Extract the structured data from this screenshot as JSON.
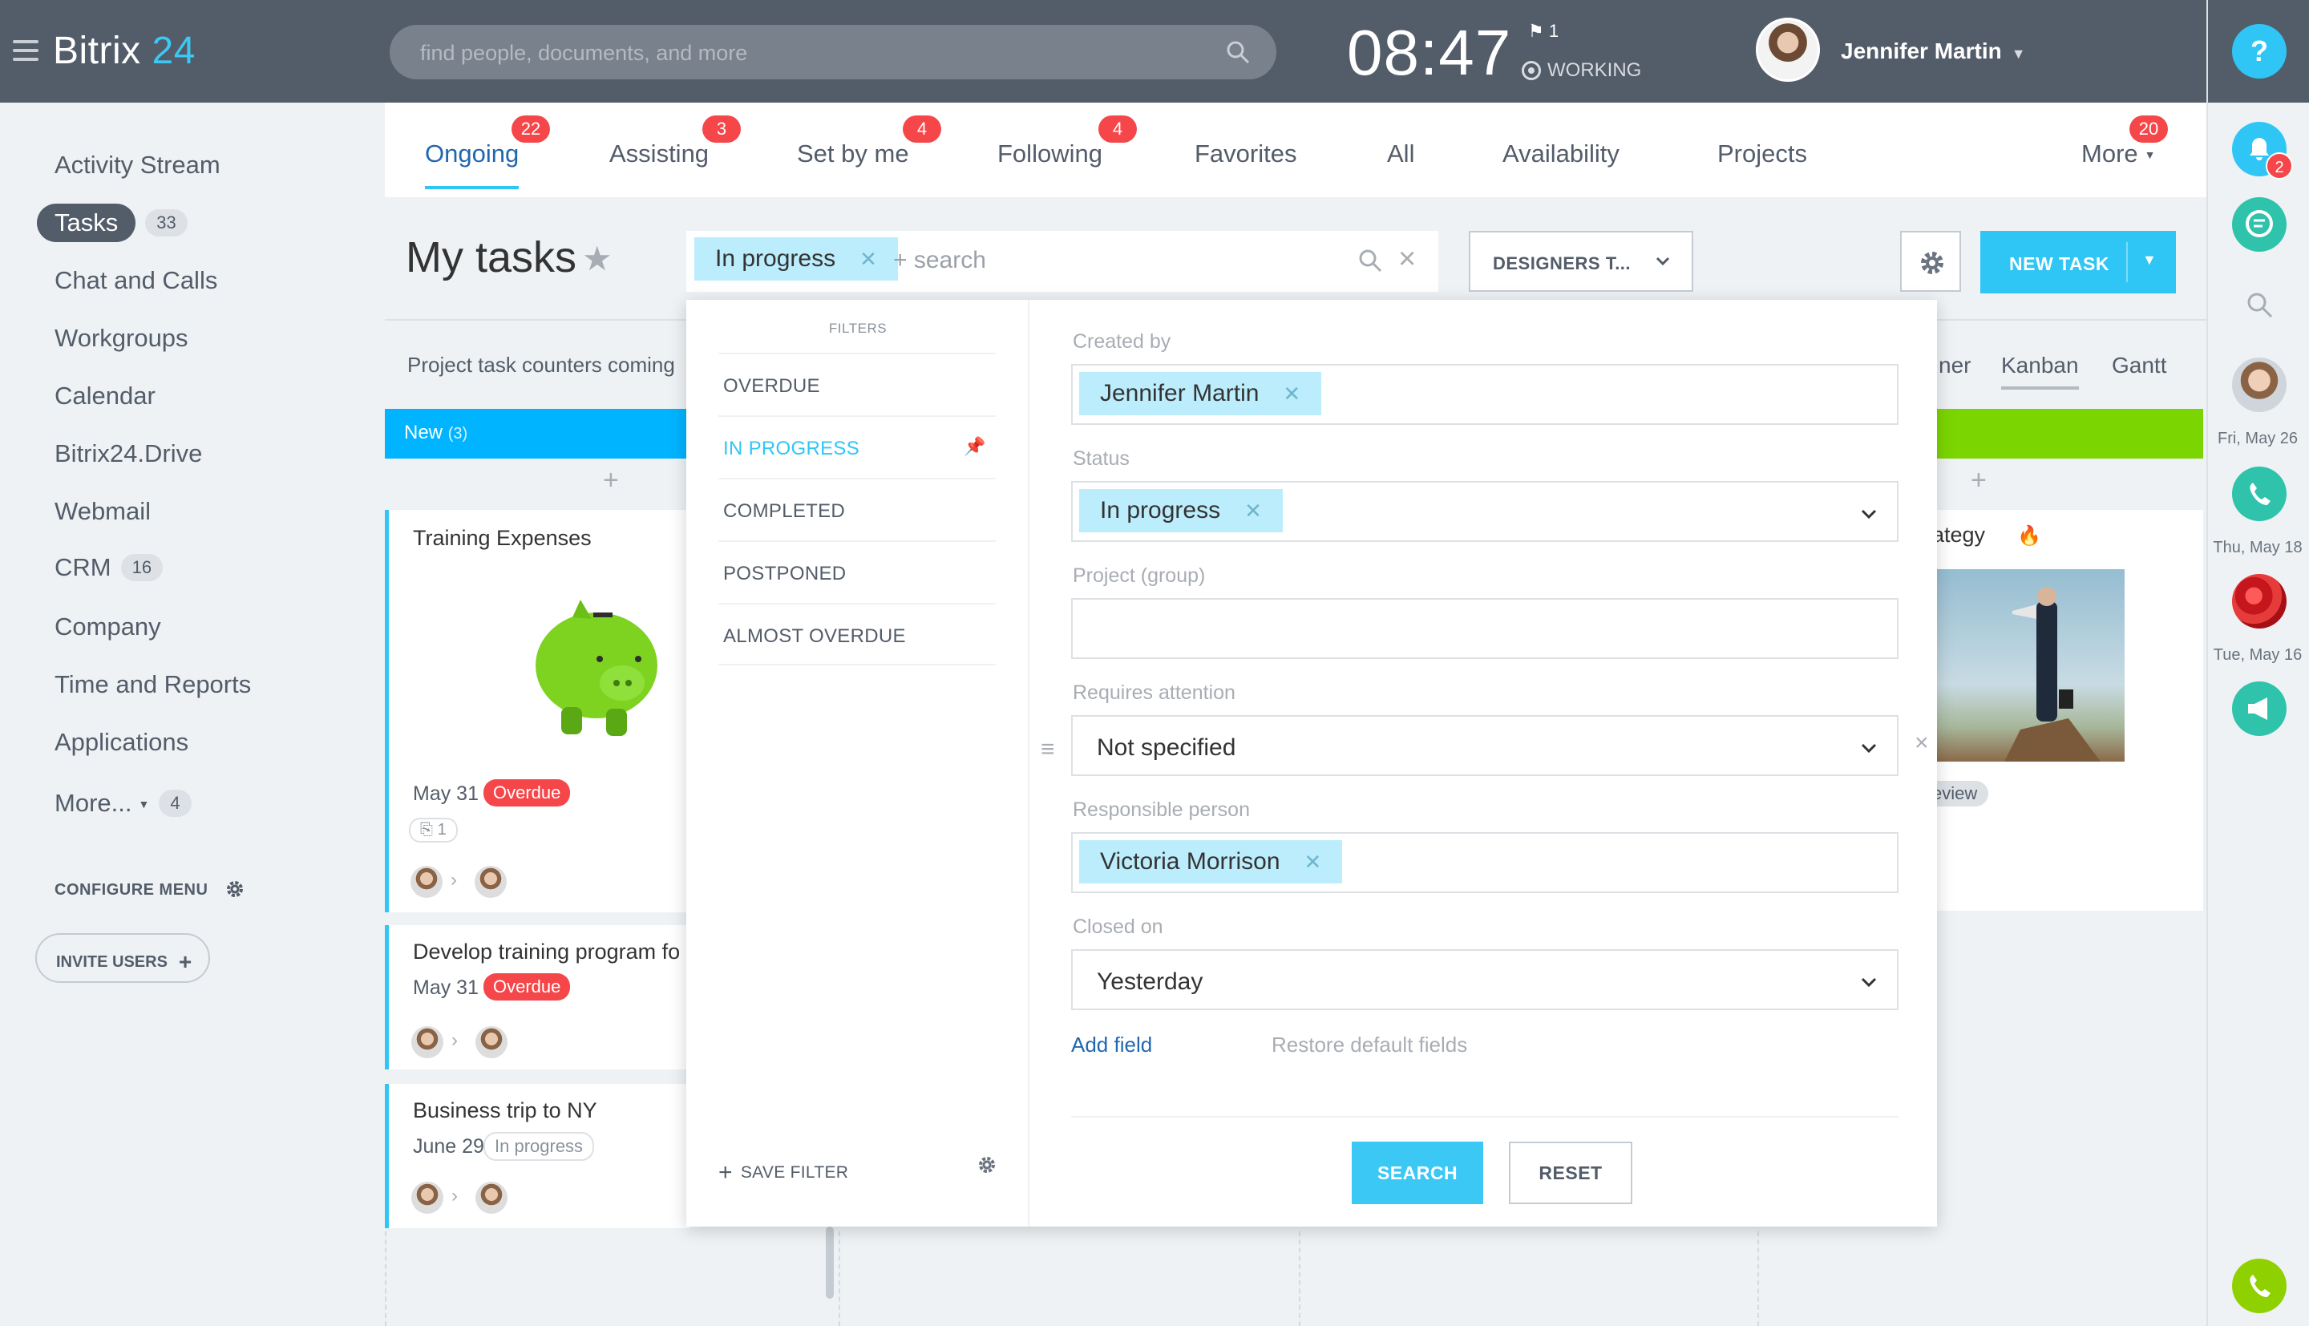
{
  "header": {
    "logo_main": "Bitrix",
    "logo_num": "24",
    "search_placeholder": "find people, documents, and more",
    "clock": "08:47",
    "flag_count": "1",
    "work_status": "WORKING",
    "user_name": "Jennifer Martin"
  },
  "sidebar": {
    "items": [
      {
        "label": "Activity Stream"
      },
      {
        "label": "Tasks",
        "counter": "33"
      },
      {
        "label": "Chat and Calls"
      },
      {
        "label": "Workgroups"
      },
      {
        "label": "Calendar"
      },
      {
        "label": "Bitrix24.Drive"
      },
      {
        "label": "Webmail"
      },
      {
        "label": "CRM",
        "counter": "16"
      },
      {
        "label": "Company"
      },
      {
        "label": "Time and Reports"
      },
      {
        "label": "Applications"
      },
      {
        "label": "More...",
        "counter": "4"
      }
    ],
    "configure_menu": "CONFIGURE MENU",
    "invite_users": "INVITE USERS"
  },
  "tabs": [
    {
      "label": "Ongoing",
      "badge": "22"
    },
    {
      "label": "Assisting",
      "badge": "3"
    },
    {
      "label": "Set by me",
      "badge": "4"
    },
    {
      "label": "Following",
      "badge": "4"
    },
    {
      "label": "Favorites"
    },
    {
      "label": "All"
    },
    {
      "label": "Availability"
    },
    {
      "label": "Projects"
    },
    {
      "label": "More",
      "badge": "20"
    }
  ],
  "toolbar": {
    "page_title": "My tasks",
    "filter_chip": "In progress",
    "search_placeholder": "+ search",
    "designers_label": "DESIGNERS T...",
    "new_task_label": "NEW TASK"
  },
  "subheader": {
    "counters_note": "Project task counters coming",
    "views": [
      "ner",
      "Kanban",
      "Gantt"
    ]
  },
  "kanban": {
    "new_column": {
      "title": "New",
      "count": "(3)"
    },
    "cards": [
      {
        "title": "Training Expenses",
        "date": "May 31",
        "status": "Overdue",
        "attachments": "1"
      },
      {
        "title": "Develop training program fo",
        "date": "May 31",
        "status": "Overdue"
      },
      {
        "title": "Business trip to NY",
        "date": "June 29",
        "status": "In progress"
      }
    ],
    "right_card": {
      "title": "ategy",
      "tag": "eview"
    }
  },
  "filter_popup": {
    "header": "FILTERS",
    "presets": [
      "OVERDUE",
      "IN PROGRESS",
      "COMPLETED",
      "POSTPONED",
      "ALMOST OVERDUE"
    ],
    "active_preset": "IN PROGRESS",
    "save_filter": "SAVE FILTER",
    "fields": {
      "created_by": {
        "label": "Created by",
        "value": "Jennifer Martin"
      },
      "status": {
        "label": "Status",
        "value": "In progress"
      },
      "project": {
        "label": "Project (group)",
        "value": ""
      },
      "requires_attention": {
        "label": "Requires attention",
        "value": "Not specified"
      },
      "responsible": {
        "label": "Responsible person",
        "value": "Victoria Morrison"
      },
      "closed_on": {
        "label": "Closed on",
        "value": "Yesterday"
      }
    },
    "add_field": "Add field",
    "restore_defaults": "Restore default fields",
    "search_button": "SEARCH",
    "reset_button": "RESET"
  },
  "right_rail": {
    "help": "?",
    "notifications_badge": "2",
    "dates": [
      "Fri, May 26",
      "Thu, May 18",
      "Tue, May 16"
    ]
  },
  "colors": {
    "header_bg": "#535c69",
    "accent": "#2fc6f6",
    "badge_red": "#f5474a",
    "new_column": "#00b4ff",
    "green_column": "#7bd500"
  }
}
